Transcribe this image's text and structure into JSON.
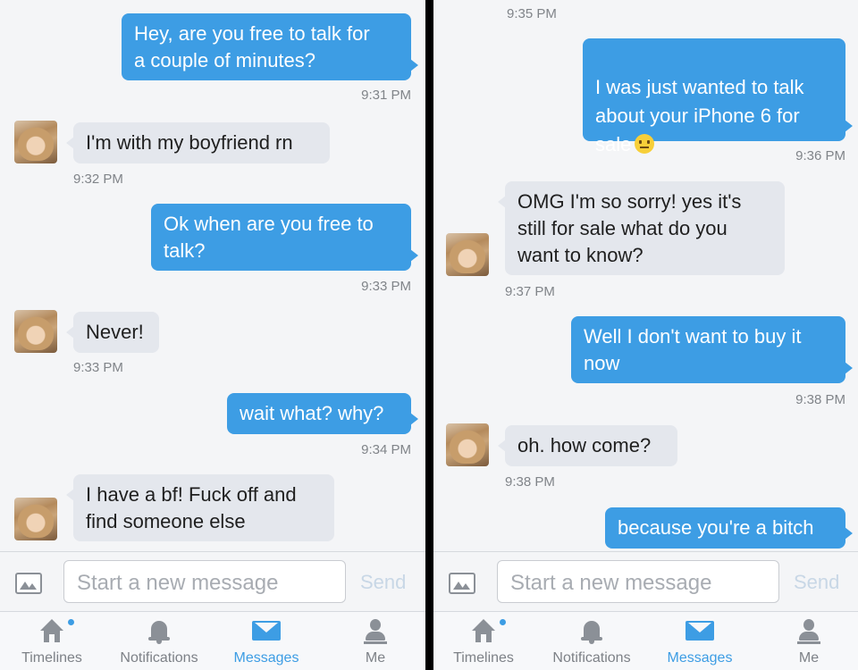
{
  "left": {
    "messages": [
      {
        "dir": "out",
        "text": "Hey, are you free to talk for\na couple of minutes?",
        "time": "9:31 PM"
      },
      {
        "dir": "in",
        "text": "I'm with my boyfriend rn",
        "time": "9:32 PM"
      },
      {
        "dir": "out",
        "text": "Ok when are you free to\ntalk?",
        "time": "9:33 PM"
      },
      {
        "dir": "in",
        "text": "Never!",
        "time": "9:33 PM"
      },
      {
        "dir": "out",
        "text": "wait what? why?",
        "time": "9:34 PM"
      },
      {
        "dir": "in",
        "text": "I have a bf! Fuck off and\nfind someone else",
        "time": ""
      }
    ]
  },
  "right": {
    "top_time": "9:35 PM",
    "messages": [
      {
        "dir": "out",
        "text": "I was just wanted to talk\nabout your iPhone 6 for\nsale",
        "emoji": "neutral-face",
        "time": "9:36 PM"
      },
      {
        "dir": "in",
        "text": "OMG I'm so sorry! yes it's\nstill for sale what do you\nwant to know?",
        "time": "9:37 PM"
      },
      {
        "dir": "out",
        "text": "Well I don't want to buy it\nnow",
        "time": "9:38 PM"
      },
      {
        "dir": "in",
        "text": "oh. how come?",
        "time": "9:38 PM"
      },
      {
        "dir": "out",
        "text": "because you're a bitch",
        "time": ""
      }
    ]
  },
  "composer": {
    "placeholder": "Start a new message",
    "send_label": "Send"
  },
  "tabs": [
    {
      "label": "Timelines",
      "icon": "home-icon",
      "active": false,
      "badge": true
    },
    {
      "label": "Notifications",
      "icon": "bell-icon",
      "active": false
    },
    {
      "label": "Messages",
      "icon": "mail-icon",
      "active": true
    },
    {
      "label": "Me",
      "icon": "person-icon",
      "active": false
    }
  ],
  "colors": {
    "accent": "#3d9de4",
    "incoming_bubble": "#e4e7ed",
    "timestamp": "#808489"
  }
}
